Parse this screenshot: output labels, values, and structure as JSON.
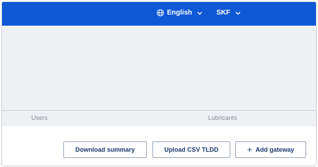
{
  "header": {
    "language": "English",
    "organization": "SKF",
    "accent": "#0f58d6"
  },
  "icons": {
    "language_icon": "globe-icon",
    "dropdown_icon": "chevron-down-icon",
    "add_icon": "plus-icon"
  },
  "nav": {
    "tabs": [
      {
        "label": "Users"
      },
      {
        "label": "Lubricants"
      }
    ]
  },
  "actions": {
    "download_summary": "Download summary",
    "upload_csv": "Upload CSV TLDD",
    "add_gateway": "Add gateway",
    "add_symbol": "+"
  }
}
